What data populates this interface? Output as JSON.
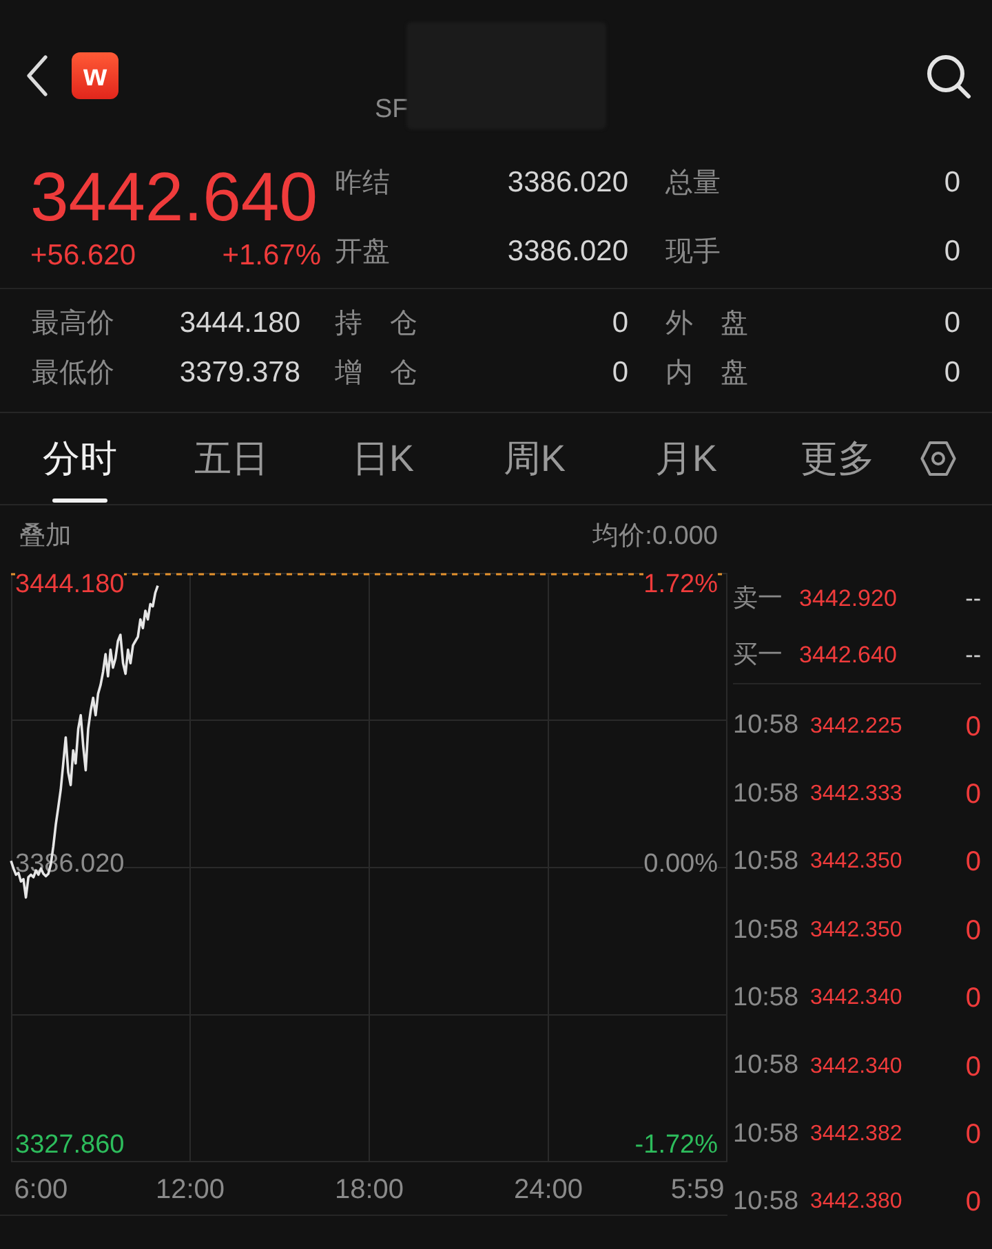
{
  "header": {
    "logo_letter": "w",
    "subtitle": "SF"
  },
  "quote": {
    "price": "3442.640",
    "change": "+56.620",
    "change_percent": "+1.67%",
    "rising": true,
    "fields": [
      {
        "label": "昨结",
        "value": "3386.020"
      },
      {
        "label": "总量",
        "value": "0"
      },
      {
        "label": "开盘",
        "value": "3386.020"
      },
      {
        "label": "现手",
        "value": "0"
      }
    ]
  },
  "stats": [
    {
      "label": "最高价",
      "value": "3444.180"
    },
    {
      "label": "持　仓",
      "value": "0"
    },
    {
      "label": "外　盘",
      "value": "0"
    },
    {
      "label": "最低价",
      "value": "3379.378"
    },
    {
      "label": "增　仓",
      "value": "0"
    },
    {
      "label": "内　盘",
      "value": "0"
    }
  ],
  "tabs": [
    {
      "label": "分时",
      "selected": true
    },
    {
      "label": "五日",
      "selected": false
    },
    {
      "label": "日K",
      "selected": false
    },
    {
      "label": "周K",
      "selected": false
    },
    {
      "label": "月K",
      "selected": false
    },
    {
      "label": "更多",
      "selected": false
    }
  ],
  "chart": {
    "overlay_label": "叠加",
    "average_price": "均价:0.000",
    "percent_ticks": [
      {
        "label": "1.72%",
        "kind": "up"
      },
      {
        "label": "0.00%",
        "kind": "flat"
      },
      {
        "label": "-1.72%",
        "kind": "down"
      }
    ],
    "chart_data": {
      "type": "line",
      "categories": [
        null,
        null,
        null,
        null,
        null,
        null,
        null,
        null,
        null,
        null,
        null,
        null,
        "6:00",
        null,
        null,
        null,
        null,
        null,
        null,
        null,
        null,
        null,
        null,
        null,
        null,
        null,
        null,
        null,
        null,
        null,
        null,
        null,
        null,
        null,
        null,
        null,
        null,
        null,
        null,
        null,
        null,
        null,
        null,
        null,
        null,
        null,
        null,
        null,
        null,
        null,
        null,
        null,
        null,
        null,
        null,
        null,
        null,
        null,
        null,
        null,
        null,
        null,
        null,
        null,
        null,
        null,
        null,
        null,
        null,
        null,
        null,
        null,
        "12:00",
        null,
        null,
        null,
        null,
        null,
        null,
        null,
        null,
        null,
        null,
        null,
        null,
        null,
        null,
        null,
        null,
        null,
        null,
        null,
        null,
        null,
        null,
        null,
        null,
        null,
        null,
        null,
        null,
        null,
        null,
        null,
        null,
        null,
        null,
        null,
        null,
        null,
        null,
        null,
        null,
        null,
        null,
        null,
        null,
        null,
        null,
        null,
        null,
        null,
        null,
        null,
        null,
        null,
        null,
        null,
        null,
        null,
        null,
        null,
        null,
        null,
        null,
        null,
        null,
        null,
        null,
        null,
        null,
        null,
        null,
        null,
        "18:00",
        null,
        null,
        null,
        null,
        null,
        null,
        null,
        null,
        null,
        null,
        null,
        null,
        null,
        null,
        null,
        null,
        null,
        null,
        null,
        null,
        null,
        null,
        null,
        null,
        null,
        null,
        null,
        null,
        null,
        null,
        null,
        null,
        null,
        null,
        null,
        null,
        null,
        null,
        null,
        null,
        null,
        null,
        null,
        null,
        null,
        null,
        null,
        null,
        null,
        null,
        null,
        null,
        null,
        null,
        null,
        null,
        null,
        null,
        null,
        null,
        null,
        null,
        null,
        null,
        null,
        null,
        null,
        null,
        null,
        null,
        null,
        "24:00",
        null,
        null,
        null,
        null,
        null,
        null,
        null,
        null,
        null,
        null,
        null,
        null,
        null,
        null,
        null,
        null,
        null,
        null,
        null,
        null,
        null,
        null,
        null,
        null,
        null,
        null,
        null,
        null,
        null,
        null,
        null,
        null,
        null,
        null,
        null,
        null,
        null,
        null,
        null,
        null,
        null,
        null,
        null,
        null,
        null,
        null,
        null,
        null,
        null,
        null,
        null,
        null,
        null,
        null,
        null,
        null,
        null,
        null,
        null,
        "5:59",
        null,
        null,
        null,
        null,
        null,
        null,
        null,
        null,
        null,
        null,
        null,
        null
      ],
      "series": [
        {
          "color": "#e6e6e6",
          "values": [
            3387.0,
            3385.4,
            3384.1,
            3384.5,
            3382.7,
            3383.2,
            3379.4,
            3383.6,
            3384.1,
            3383.6,
            3385.0,
            3384.1,
            3385.4,
            3384.3,
            3383.8,
            3384.3,
            3386.3,
            3390.0,
            3394.5,
            3398.1,
            3401.8,
            3407.2,
            3412.6,
            3405.4,
            3402.7,
            3409.9,
            3407.2,
            3414.4,
            3417.2,
            3410.8,
            3405.8,
            3414.4,
            3418.1,
            3420.8,
            3417.2,
            3421.7,
            3423.5,
            3426.2,
            3429.9,
            3425.3,
            3430.8,
            3427.1,
            3429.0,
            3432.6,
            3433.9,
            3428.0,
            3425.8,
            3430.8,
            3428.0,
            3431.7,
            3432.6,
            3433.5,
            3437.1,
            3435.3,
            3438.9,
            3437.1,
            3440.3,
            3439.8,
            3442.6,
            3444.1,
            null,
            null,
            null,
            null,
            null,
            null,
            null,
            null,
            null,
            null,
            null,
            null,
            null,
            null,
            null,
            null,
            null,
            null,
            null,
            null,
            null,
            null,
            null,
            null,
            null,
            null,
            null,
            null,
            null,
            null,
            null,
            null,
            null,
            null,
            null,
            null,
            null,
            null,
            null,
            null,
            null,
            null,
            null,
            null,
            null,
            null,
            null,
            null,
            null,
            null,
            null,
            null,
            null,
            null,
            null,
            null,
            null,
            null,
            null,
            null,
            null,
            null,
            null,
            null,
            null,
            null,
            null,
            null,
            null,
            null,
            null,
            null,
            null,
            null,
            null,
            null,
            null,
            null,
            null,
            null,
            null,
            null,
            null,
            null,
            null,
            null,
            null,
            null,
            null,
            null,
            null,
            null,
            null,
            null,
            null,
            null,
            null,
            null,
            null,
            null,
            null,
            null,
            null,
            null,
            null,
            null,
            null,
            null,
            null,
            null,
            null,
            null,
            null,
            null,
            null,
            null,
            null,
            null,
            null,
            null,
            null,
            null,
            null,
            null,
            null,
            null,
            null,
            null,
            null,
            null,
            null,
            null,
            null,
            null,
            null,
            null,
            null,
            null,
            null,
            null,
            null,
            null,
            null,
            null,
            null,
            null,
            null,
            null,
            null,
            null,
            null,
            null,
            null,
            null,
            null,
            null,
            null,
            null,
            null,
            null,
            null,
            null,
            null,
            null,
            null,
            null,
            null,
            null,
            null,
            null,
            null,
            null,
            null,
            null,
            null,
            null,
            null,
            null,
            null,
            null,
            null,
            null,
            null,
            null,
            null,
            null,
            null,
            null,
            null,
            null,
            null,
            null,
            null,
            null,
            null,
            null,
            null,
            null,
            null,
            null,
            null,
            null,
            null,
            null,
            null,
            null,
            null,
            null,
            null,
            null,
            null,
            null,
            null,
            null,
            null,
            null,
            null,
            null,
            null,
            null,
            null,
            null,
            null,
            null,
            null,
            null,
            null,
            null,
            null
          ]
        }
      ],
      "ylim": [
        3324.43,
        3446.75
      ],
      "yticks": [
        {
          "value": 3444.18,
          "label": "3444.180"
        },
        {
          "value": 3386.02,
          "label": "3386.020"
        },
        {
          "value": 3327.86,
          "label": "3327.860"
        }
      ]
    }
  },
  "order_book": [
    {
      "label": "卖一",
      "price": "3442.920",
      "volume": "--",
      "rising": true
    },
    {
      "label": "买一",
      "price": "3442.640",
      "volume": "--",
      "rising": true
    }
  ],
  "trades": [
    {
      "time": "10:58",
      "price": "3442.225",
      "volume": "0",
      "rising": true
    },
    {
      "time": "10:58",
      "price": "3442.333",
      "volume": "0",
      "rising": true
    },
    {
      "time": "10:58",
      "price": "3442.350",
      "volume": "0",
      "rising": true
    },
    {
      "time": "10:58",
      "price": "3442.350",
      "volume": "0",
      "rising": true
    },
    {
      "time": "10:58",
      "price": "3442.340",
      "volume": "0",
      "rising": true
    },
    {
      "time": "10:58",
      "price": "3442.340",
      "volume": "0",
      "rising": true
    },
    {
      "time": "10:58",
      "price": "3442.382",
      "volume": "0",
      "rising": true
    },
    {
      "time": "10:58",
      "price": "3442.380",
      "volume": "0",
      "rising": true
    }
  ]
}
